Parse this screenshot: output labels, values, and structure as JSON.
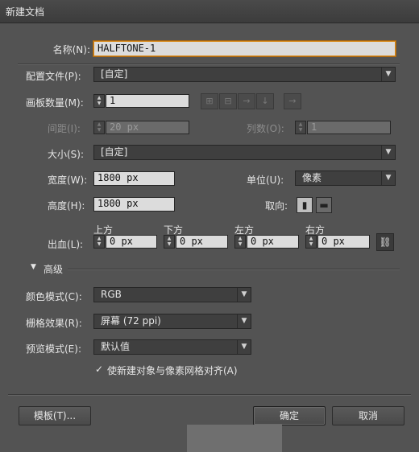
{
  "window": {
    "title": "新建文档"
  },
  "name": {
    "label": "名称(N):",
    "value": "HALFTONE-1"
  },
  "profile": {
    "label": "配置文件(P):",
    "value": "[自定]"
  },
  "artboards": {
    "count_label": "画板数量(M):",
    "count": "1",
    "spacing_label": "间距(I):",
    "spacing": "20 px",
    "columns_label": "列数(O):",
    "columns": "1"
  },
  "size": {
    "label": "大小(S):",
    "value": "[自定]"
  },
  "width": {
    "label": "宽度(W):",
    "value": "1800 px"
  },
  "height": {
    "label": "高度(H):",
    "value": "1800 px"
  },
  "units": {
    "label": "单位(U):",
    "value": "像素"
  },
  "orientation": {
    "label": "取向:"
  },
  "bleed": {
    "label": "出血(L):",
    "top_label": "上方",
    "bottom_label": "下方",
    "left_label": "左方",
    "right_label": "右方",
    "top": "0 px",
    "bottom": "0 px",
    "left": "0 px",
    "right": "0 px"
  },
  "advanced": {
    "label": "高级",
    "color_mode_label": "颜色模式(C):",
    "color_mode": "RGB",
    "raster_label": "栅格效果(R):",
    "raster": "屏幕 (72 ppi)",
    "preview_label": "预览模式(E):",
    "preview": "默认值",
    "align_label": "使新建对象与像素网格对齐(A)"
  },
  "buttons": {
    "templates": "模板(T)...",
    "ok": "确定",
    "cancel": "取消"
  }
}
